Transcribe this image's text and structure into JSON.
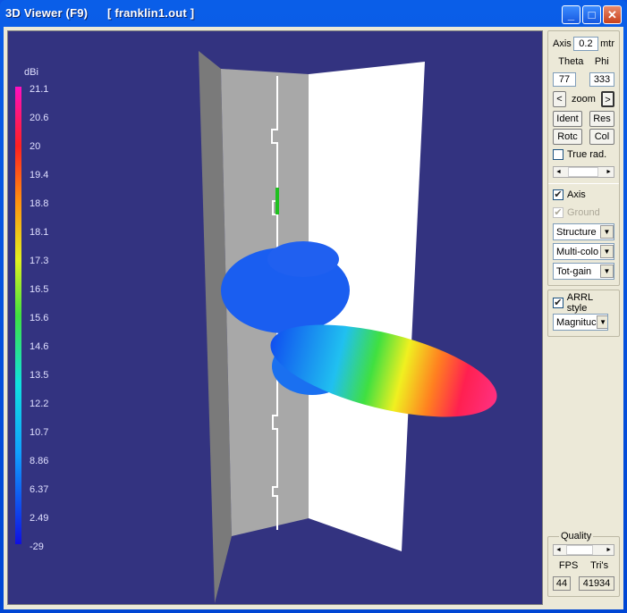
{
  "window": {
    "title": "Viewer (F9)",
    "file": "[  franklin1.out ]",
    "icon": "3D"
  },
  "titlebar_buttons": {
    "minimize": "_",
    "maximize": "□",
    "close": "✕"
  },
  "colorbar": {
    "unit": "dBi",
    "labels": [
      "21.1",
      "20.6",
      "20",
      "19.4",
      "18.8",
      "18.1",
      "17.3",
      "16.5",
      "15.6",
      "14.6",
      "13.5",
      "12.2",
      "10.7",
      "8.86",
      "6.37",
      "2.49",
      "-29"
    ]
  },
  "panel": {
    "axis_label": "Axis",
    "axis_value": "0.2",
    "axis_unit": "mtr",
    "theta_label": "Theta",
    "phi_label": "Phi",
    "theta_value": "77",
    "phi_value": "333",
    "zoom_label": "zoom",
    "zoom_prev": "<",
    "zoom_next": ">",
    "ident": "Ident",
    "res": "Res",
    "rotc": "Rotc",
    "col": "Col",
    "true_rad": "True rad.",
    "true_rad_checked": false,
    "axis_chk": "Axis",
    "axis_checked": true,
    "ground_chk": "Ground",
    "ground_checked": true,
    "select_structure": "Structure",
    "select_color": "Multi-colo",
    "select_gain": "Tot-gain",
    "arrl_style": "ARRL style",
    "arrl_checked": true,
    "select_magnitude": "Magnituc",
    "quality_label": "Quality",
    "fps_label": "FPS",
    "tris_label": "Tri's",
    "fps_value": "44",
    "tris_value": "41934"
  }
}
